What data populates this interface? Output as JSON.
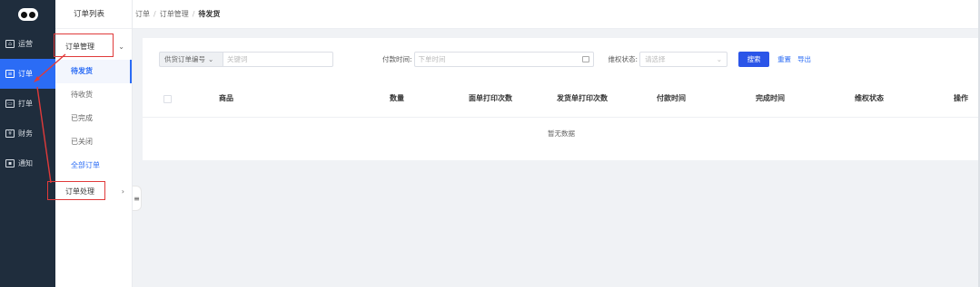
{
  "rail": {
    "items": [
      {
        "label": "运营",
        "icon": "home-icon"
      },
      {
        "label": "订单",
        "icon": "order-icon",
        "active": true
      },
      {
        "label": "打单",
        "icon": "print-icon"
      },
      {
        "label": "财务",
        "icon": "yen-icon"
      },
      {
        "label": "通知",
        "icon": "notice-icon"
      }
    ]
  },
  "subnav": {
    "title": "订单列表",
    "group1": "订单管理",
    "items": [
      "待发货",
      "待收货",
      "已完成",
      "已关闭",
      "全部订单"
    ],
    "group2": "订单处理"
  },
  "breadcrumb": [
    "订单",
    "订单管理",
    "待发货"
  ],
  "filters": {
    "field_select": "供货订单编号",
    "keyword_placeholder": "关键词",
    "pay_time_label": "付款时间:",
    "pay_time_placeholder": "下单时间",
    "rights_label": "维权状态:",
    "rights_placeholder": "请选择",
    "search_button": "搜索",
    "reset_button": "重置",
    "export_button": "导出"
  },
  "table": {
    "columns": [
      "商品",
      "数量",
      "面单打印次数",
      "发货单打印次数",
      "付款时间",
      "完成时间",
      "维权状态",
      "操作"
    ],
    "empty_text": "暂无数据"
  },
  "colors": {
    "accent": "#2b6cf5",
    "rail": "#1f2d3d",
    "annotation": "#e03a3a"
  }
}
